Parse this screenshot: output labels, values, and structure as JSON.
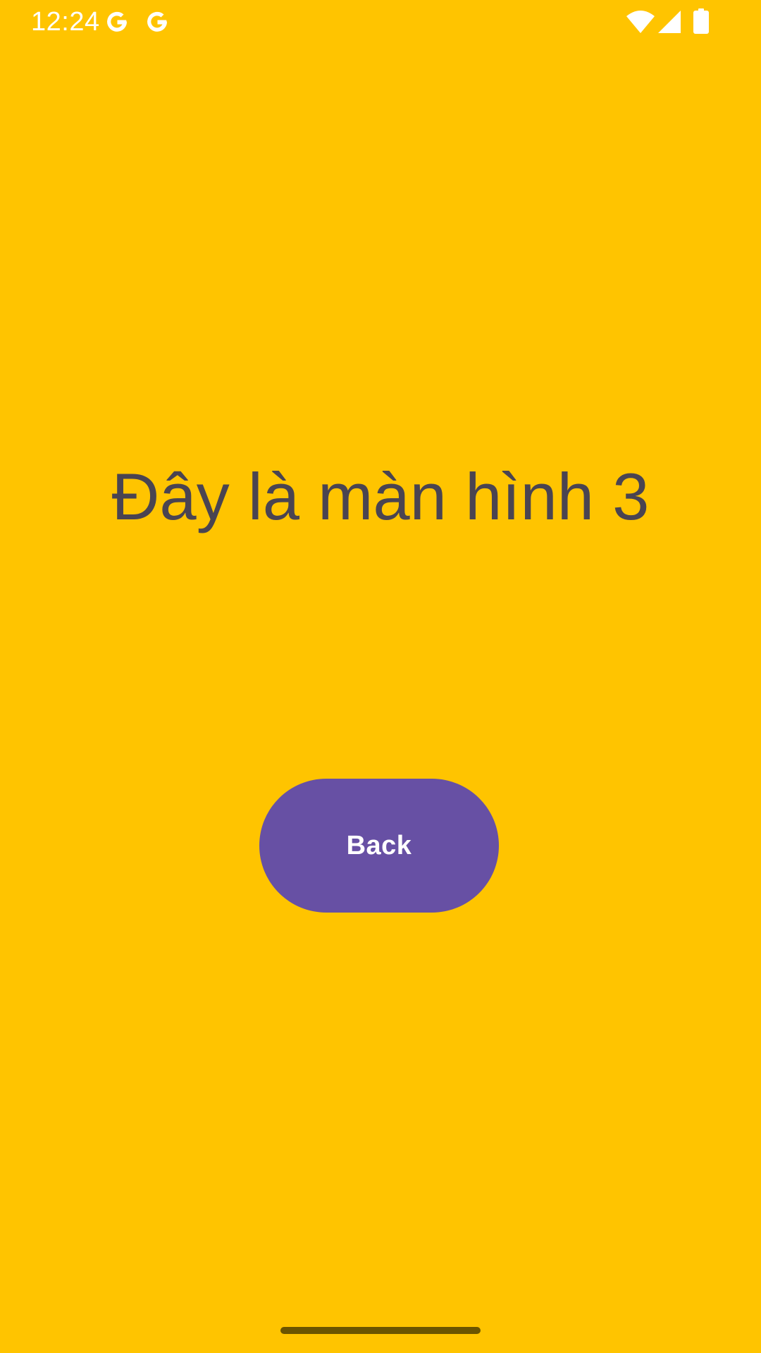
{
  "status_bar": {
    "time": "12:24",
    "notification_icons": [
      "google-icon",
      "google-icon"
    ],
    "system_icons": [
      "wifi-icon",
      "cellular-signal-icon",
      "battery-icon"
    ]
  },
  "main": {
    "title": "Đây là màn hình 3",
    "back_button_label": "Back"
  },
  "colors": {
    "background": "#FFC400",
    "title_text": "#4A4451",
    "button_background": "#6750A4",
    "button_text": "#FFFFFF",
    "nav_handle": "#6B5400"
  }
}
